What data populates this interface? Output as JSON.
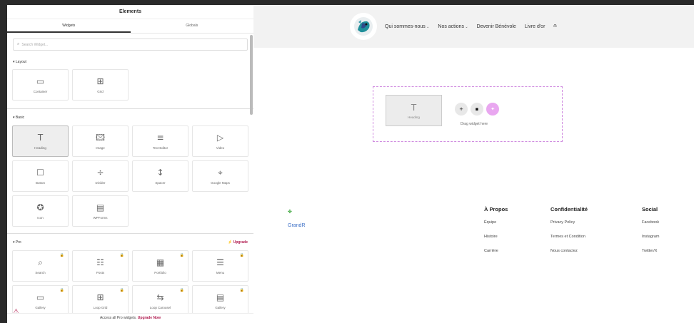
{
  "panel": {
    "title": "Elements",
    "tabs": [
      "Widgets",
      "Globals"
    ],
    "search_placeholder": "Search Widget...",
    "sections": {
      "layout": {
        "label": "▾ Layout",
        "items": [
          {
            "label": "Container",
            "icon": "▭"
          },
          {
            "label": "Grid",
            "icon": "⊞"
          }
        ]
      },
      "basic": {
        "label": "▾ Basic",
        "items": [
          {
            "label": "Heading",
            "icon": "T"
          },
          {
            "label": "Image",
            "icon": "🖾"
          },
          {
            "label": "Text Editor",
            "icon": "≡"
          },
          {
            "label": "Video",
            "icon": "▷"
          },
          {
            "label": "Button",
            "icon": "☐"
          },
          {
            "label": "Divider",
            "icon": "÷"
          },
          {
            "label": "Spacer",
            "icon": "↕"
          },
          {
            "label": "Google Maps",
            "icon": "⌖"
          },
          {
            "label": "Icon",
            "icon": "✪"
          },
          {
            "label": "WPForms",
            "icon": "▤"
          }
        ]
      },
      "pro": {
        "label": "▾ Pro",
        "upgrade": "⚡ Upgrade",
        "items": [
          {
            "label": "Search",
            "icon": "⌕"
          },
          {
            "label": "Posts",
            "icon": "☷"
          },
          {
            "label": "Portfolio",
            "icon": "▦"
          },
          {
            "label": "Menu",
            "icon": "☰"
          },
          {
            "label": "Gallery",
            "icon": "▭"
          },
          {
            "label": "Loop Grid",
            "icon": "⊞"
          },
          {
            "label": "Loop Carousel",
            "icon": "⇆"
          },
          {
            "label": "Gallery",
            "icon": "▤"
          }
        ]
      }
    },
    "footer_text": "Access all Pro widgets.",
    "footer_link": "Upgrade Now"
  },
  "site": {
    "nav": [
      {
        "label": "Qui sommes-nous",
        "dropdown": true
      },
      {
        "label": "Nos actions",
        "dropdown": true
      },
      {
        "label": "Devenir Bénévole",
        "dropdown": false
      },
      {
        "label": "Livre d'or",
        "dropdown": false
      }
    ],
    "drop": {
      "preview_label": "Heading",
      "buttons": [
        "+",
        "▪",
        "✦"
      ],
      "hint": "Drag widget here"
    },
    "footer": {
      "brand": "GrandR",
      "columns": [
        {
          "title": "À Propos",
          "links": [
            "Équipe",
            "Histoire",
            "Carrière"
          ]
        },
        {
          "title": "Confidentialité",
          "links": [
            "Privacy Policy",
            "Termes et Condition",
            "Nous contactez"
          ]
        },
        {
          "title": "Social",
          "links": [
            "Facebook",
            "Instagram",
            "Twitter/X"
          ]
        }
      ]
    }
  },
  "colors": {
    "accent": "#b01b4f",
    "drop_border": "#d08ce0",
    "brand_link": "#3c6fc6"
  }
}
